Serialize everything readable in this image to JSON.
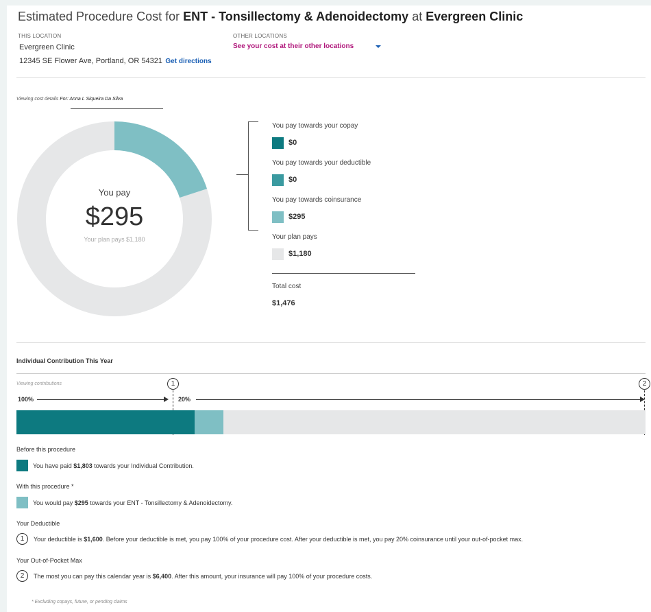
{
  "header": {
    "title_prefix": "Estimated Procedure Cost for",
    "procedure": "ENT - Tonsillectomy & Adenoidectomy",
    "title_mid": "at",
    "clinic": "Evergreen Clinic"
  },
  "this_location": {
    "label": "THIS LOCATION",
    "name": "Evergreen Clinic",
    "address": "12345 SE Flower Ave, Portland, OR 54321",
    "directions_link": "Get directions"
  },
  "other_locations": {
    "label": "OTHER LOCATIONS",
    "link": "See your cost at their other locations"
  },
  "viewing": {
    "label": "Viewing cost details",
    "member": "For: Anna L Siqueira Da Silva"
  },
  "donut": {
    "you_pay_label": "You pay",
    "you_pay_amount": "$295",
    "plan_pays_text": "Your plan pays $1,180",
    "you_pay_fraction": 0.2,
    "colors": {
      "you_pay": "#7fbfc4",
      "plan_pays": "#e6e7e8"
    }
  },
  "legend": {
    "items": [
      {
        "label": "You pay towards your copay",
        "value": "$0",
        "color": "#0d7a80"
      },
      {
        "label": "You pay towards your deductible",
        "value": "$0",
        "color": "#3a9aa0"
      },
      {
        "label": "You pay towards coinsurance",
        "value": "$295",
        "color": "#7fbfc4"
      },
      {
        "label": "Your plan pays",
        "value": "$1,180",
        "color": "#e6e7e8"
      }
    ],
    "total_label": "Total cost",
    "total_value": "$1,476"
  },
  "contribution": {
    "title": "Individual Contribution This Year",
    "viewing_label": "Viewing contributions",
    "pct_before": "100%",
    "pct_after": "20%",
    "marker1": "1",
    "marker2": "2",
    "colors": {
      "paid": "#0d7a80",
      "this_procedure": "#7fbfc4",
      "remaining": "#e6e7e8"
    },
    "before_title": "Before this procedure",
    "before_text_pre": "You have paid ",
    "before_amount": "$1,803",
    "before_text_post": " towards your Individual Contribution.",
    "with_title": "With this procedure *",
    "with_text_pre": "You would pay ",
    "with_amount": "$295",
    "with_text_post": " towards your ENT - Tonsillectomy & Adenoidectomy.",
    "deductible_title": "Your Deductible",
    "deductible_text_pre": "Your deductible is ",
    "deductible_amount": "$1,600",
    "deductible_text_post": ". Before your deductible is met, you pay 100% of your procedure cost. After your deductible is met, you pay 20% coinsurance until your out-of-pocket max.",
    "oop_title": "Your Out-of-Pocket Max",
    "oop_text_pre": "The most you can pay this calendar year is ",
    "oop_amount": "$6,400",
    "oop_text_post": ". After this amount, your insurance will pay 100% of your procedure costs.",
    "footnote": "* Excluding copays, future, or pending claims"
  }
}
